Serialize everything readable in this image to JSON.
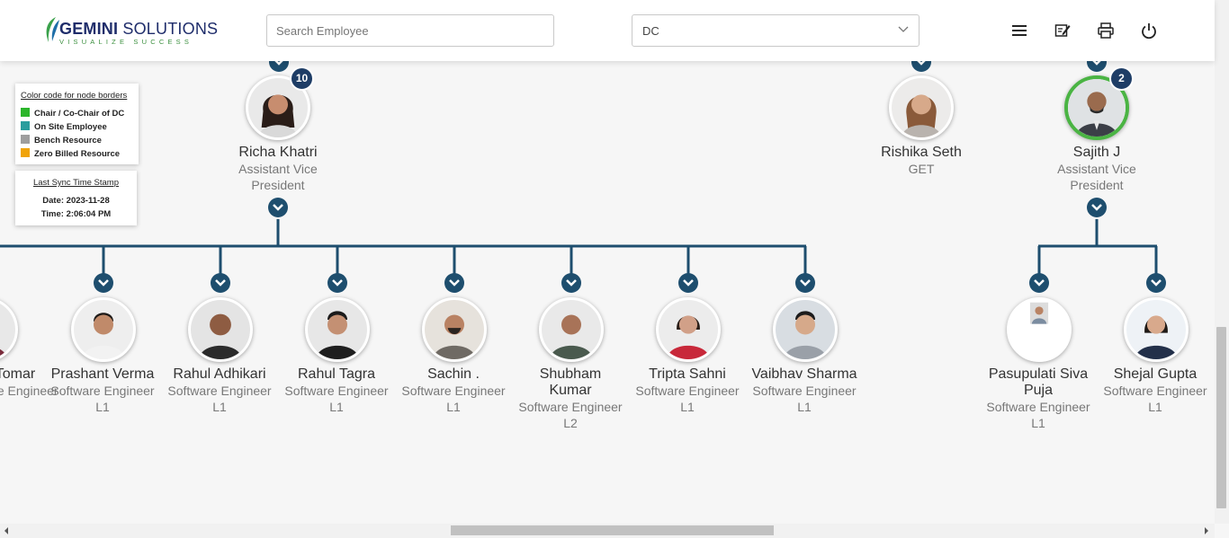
{
  "app": {
    "logo_name_bold": "GEMINI",
    "logo_name_light": " SOLUTIONS",
    "logo_tagline": "VISUALIZE SUCCESS"
  },
  "toolbar": {
    "search_placeholder": "Search Employee",
    "department_selected": "DC",
    "icons": [
      "hamburger-menu-icon",
      "edit-note-icon",
      "print-icon",
      "power-icon"
    ]
  },
  "legend": {
    "title": "Color code for node borders",
    "items": [
      {
        "label": "Chair / Co-Chair of DC",
        "color": "#2bb52b"
      },
      {
        "label": "On Site Employee",
        "color": "#2a9d9d"
      },
      {
        "label": "Bench Resource",
        "color": "#9e9e9e"
      },
      {
        "label": "Zero Billed Resource",
        "color": "#f0a30a"
      }
    ]
  },
  "sync": {
    "title": "Last Sync Time Stamp",
    "date": "Date: 2023-11-28",
    "time": "Time: 2:06:04 PM"
  },
  "managers": [
    {
      "name": "Richa Khatri",
      "title1": "Assistant Vice",
      "title2": "President",
      "count": "10"
    },
    {
      "name": "Rishika Seth",
      "title1": "GET",
      "title2": ""
    },
    {
      "name": "Sajith J",
      "title1": "Assistant Vice",
      "title2": "President",
      "count": "2",
      "border": "chair"
    }
  ],
  "reports": [
    {
      "name": "Tomar",
      "title1": "Software Engineer",
      "title2": ""
    },
    {
      "name": "Prashant Verma",
      "title1": "Software Engineer",
      "title2": "L1"
    },
    {
      "name": "Rahul Adhikari",
      "title1": "Software Engineer",
      "title2": "L1"
    },
    {
      "name": "Rahul Tagra",
      "title1": "Software Engineer",
      "title2": "L1"
    },
    {
      "name": "Sachin .",
      "title1": "Software Engineer",
      "title2": "L1"
    },
    {
      "name": "Shubham Kumar",
      "name1": "Shubham",
      "name2": "Kumar",
      "title1": "Software Engineer",
      "title2": "L2"
    },
    {
      "name": "Tripta Sahni",
      "title1": "Software Engineer",
      "title2": "L1"
    },
    {
      "name": "Vaibhav Sharma",
      "title1": "Software Engineer",
      "title2": "L1"
    },
    {
      "name": "Pasupulati Siva Puja",
      "name1": "Pasupulati Siva",
      "name2": "Puja",
      "title1": "Software Engineer",
      "title2": "L1"
    },
    {
      "name": "Shejal Gupta",
      "title1": "Software Engineer",
      "title2": "L1"
    }
  ]
}
